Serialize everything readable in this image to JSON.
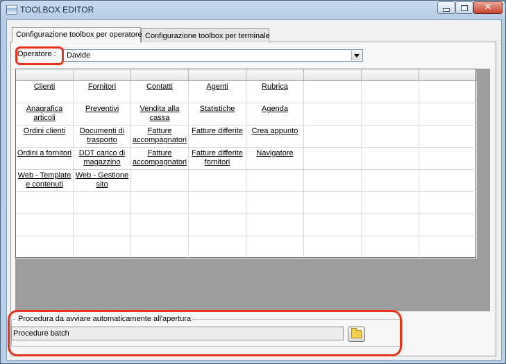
{
  "window": {
    "title": "TOOLBOX EDITOR",
    "close_glyph": "✕"
  },
  "tabs": [
    {
      "label": "Configurazione toolbox per operatore",
      "active": true
    },
    {
      "label": "Configurazione toolbox per terminale",
      "active": false
    }
  ],
  "operator": {
    "label": "Operatore :",
    "value": "Davide"
  },
  "toolbox": {
    "columns": 8,
    "rows": [
      [
        "Clienti",
        "Fornitori",
        "Contatti",
        "Agenti",
        "Rubrica"
      ],
      [
        "Anagrafica articoli",
        "Preventivi",
        "Vendita alla cassa",
        "Statistiche",
        "Agenda"
      ],
      [
        "Ordini clienti",
        "Documenti di trasporto",
        "Fatture accompagnatori",
        "Fatture differite",
        "Crea appunto"
      ],
      [
        "Ordini a fornitori",
        "DDT carico di magazzino",
        "Fatture accompagnatori",
        "Fatture differite fornitori",
        "Navigatore"
      ],
      [
        "Web - Template e contenuti",
        "Web - Gestione sito"
      ]
    ]
  },
  "startup": {
    "group_title": "Procedura da avviare automaticamente all'apertura",
    "value": "Procedure batch"
  },
  "colors": {
    "highlight": "#e8321c",
    "grid_background": "#9d9d9d"
  },
  "icons": {
    "folder": "folder-icon",
    "dropdown": "chevron-down-icon"
  }
}
